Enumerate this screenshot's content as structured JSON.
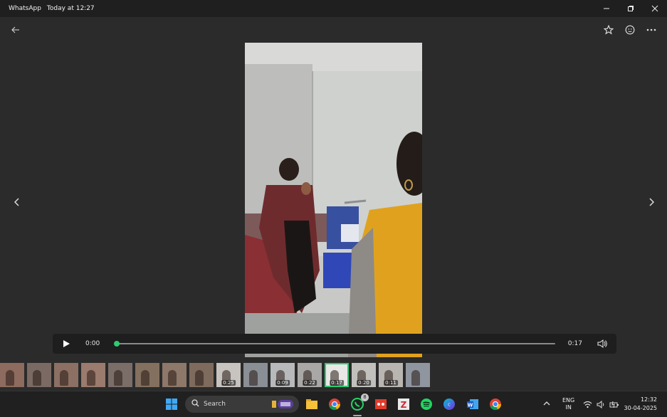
{
  "window": {
    "app_name": "WhatsApp",
    "timestamp": "Today at 12:27",
    "controls": [
      "minimize-icon",
      "restore-icon",
      "close-icon"
    ]
  },
  "viewer_toolbar": {
    "back_icon": "arrow-left-icon",
    "actions": [
      "star-icon",
      "emoji-icon",
      "more-icon"
    ]
  },
  "nav": {
    "prev_icon": "chevron-left-icon",
    "next_icon": "chevron-right-icon"
  },
  "player": {
    "current_time": "0:00",
    "duration": "0:17",
    "progress": 0.0,
    "accent": "#2ecc71"
  },
  "thumbnails": [
    {
      "duration": ""
    },
    {
      "duration": ""
    },
    {
      "duration": ""
    },
    {
      "duration": ""
    },
    {
      "duration": ""
    },
    {
      "duration": ""
    },
    {
      "duration": ""
    },
    {
      "duration": ""
    },
    {
      "duration": "0:25"
    },
    {
      "duration": ""
    },
    {
      "duration": "0:09"
    },
    {
      "duration": "0:22"
    },
    {
      "duration": "0:17",
      "selected": true
    },
    {
      "duration": "0:20"
    },
    {
      "duration": "0:11"
    },
    {
      "duration": ""
    }
  ],
  "taskbar": {
    "search_placeholder": "Search",
    "apps": [
      "windows-start-icon",
      "file-explorer-icon",
      "chrome-icon",
      "whatsapp-icon",
      "office-icon",
      "zotero-icon",
      "spotify-icon",
      "canva-icon",
      "word-icon",
      "chrome-icon"
    ],
    "whatsapp_badge": "8",
    "language": "ENG",
    "region": "IN",
    "time": "12:32",
    "date": "30-04-2025"
  }
}
